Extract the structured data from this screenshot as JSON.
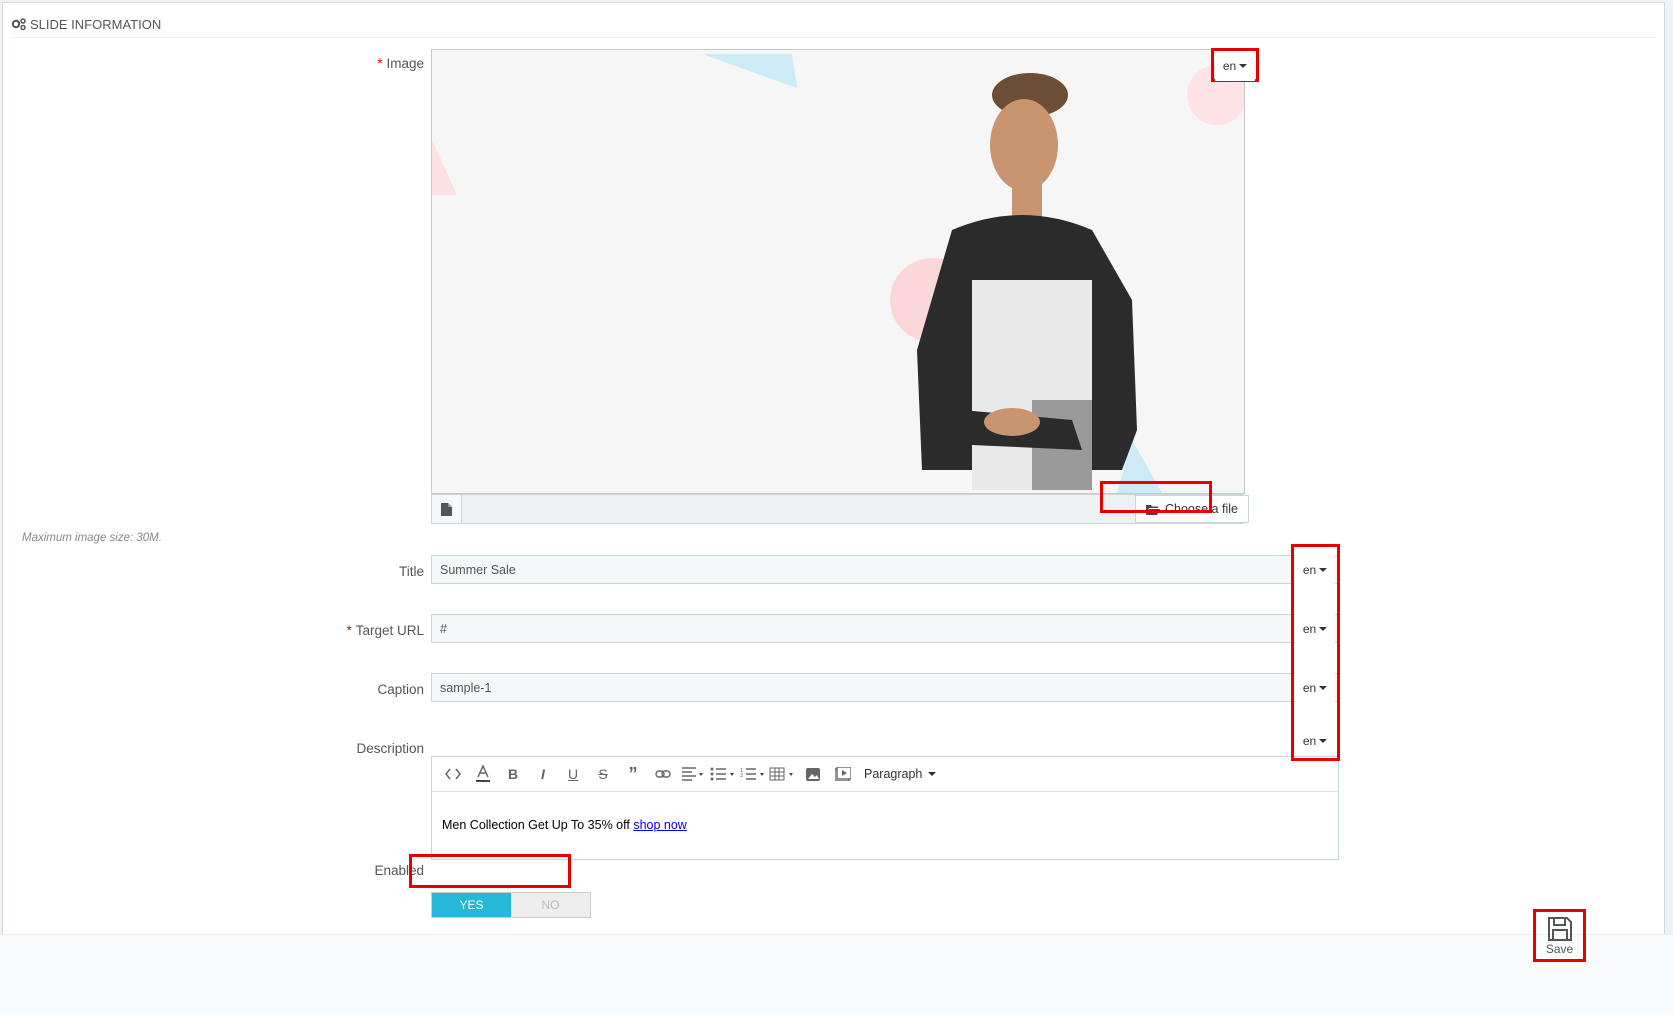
{
  "panel": {
    "heading": "SLIDE INFORMATION"
  },
  "image_field": {
    "label": "Image",
    "required_mark": "*",
    "lang": "en",
    "choose_label": "Choose a file",
    "help_text": "Maximum image size: 30M."
  },
  "fields": {
    "title": {
      "label": "Title",
      "value": "Summer Sale",
      "lang": "en"
    },
    "target_url": {
      "label": "Target URL",
      "required_mark": "*",
      "value": "#",
      "lang": "en"
    },
    "caption": {
      "label": "Caption",
      "value": "sample-1",
      "lang": "en"
    },
    "description": {
      "label": "Description",
      "lang": "en",
      "format": "Paragraph",
      "content_text": "Men Collection Get Up To 35% off ",
      "content_link": "shop now"
    }
  },
  "enabled": {
    "label": "Enabled",
    "yes": "YES",
    "no": "NO",
    "value": "YES"
  },
  "footer": {
    "save_label": "Save"
  },
  "colors": {
    "accent": "#25b9d7",
    "highlight": "#e60000"
  }
}
